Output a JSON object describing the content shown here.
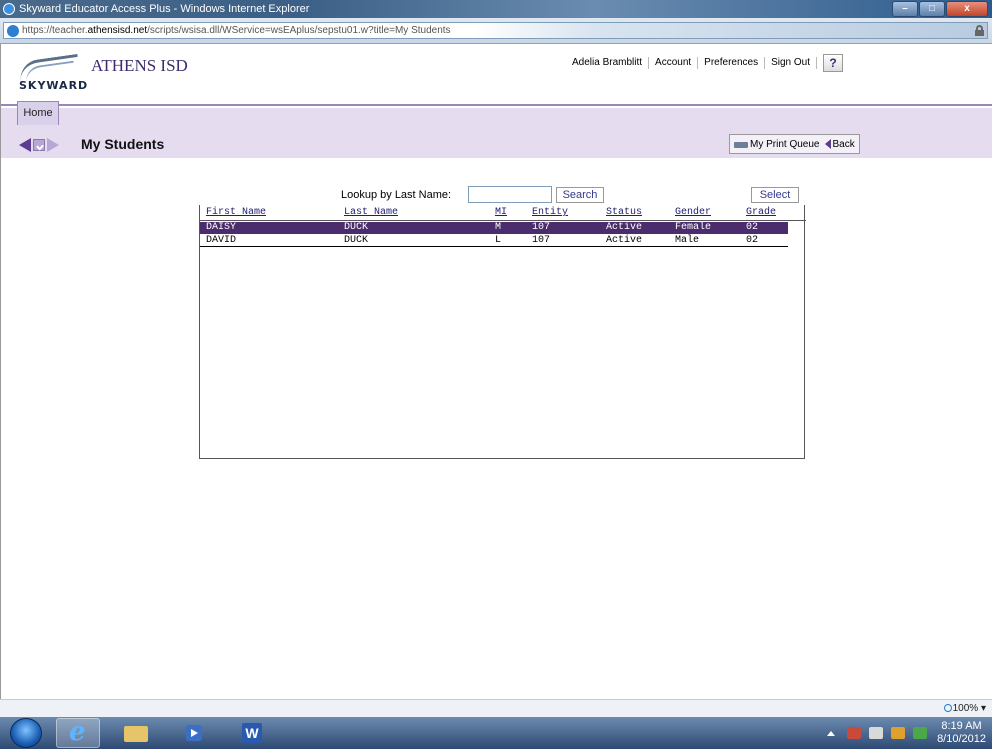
{
  "window": {
    "title": "Skyward Educator Access Plus - Windows Internet Explorer",
    "min": "–",
    "max": "□",
    "close": "x"
  },
  "address": {
    "prefix": "https://teacher.",
    "domain": "athensisd.net",
    "path": "/scripts/wsisa.dll/WService=wsEAplus/sepstu01.w?title=My Students"
  },
  "header": {
    "logo_text": "SKYWARD",
    "district": "ATHENS ISD",
    "user_name": "Adelia Bramblitt",
    "nav": [
      "Account",
      "Preferences",
      "Sign Out"
    ],
    "help": "?"
  },
  "tabs": {
    "home": "Home"
  },
  "toolbar": {
    "title": "My Students",
    "print_queue": "My Print Queue",
    "back": "Back"
  },
  "lookup": {
    "label": "Lookup by Last Name:",
    "value": "",
    "search_label": "Search",
    "select_label": "Select"
  },
  "grid": {
    "columns": [
      "First Name",
      "Last Name",
      "MI",
      "Entity",
      "Status",
      "Gender",
      "Grade"
    ],
    "rows": [
      {
        "first": "DAISY",
        "last": "DUCK",
        "mi": "M",
        "entity": "107",
        "status": "Active",
        "gender": "Female",
        "grade": "02",
        "selected": true
      },
      {
        "first": "DAVID",
        "last": "DUCK",
        "mi": "L",
        "entity": "107",
        "status": "Active",
        "gender": "Male",
        "grade": "02",
        "selected": false
      }
    ]
  },
  "statusbar": {
    "zoom": "100%",
    "zoom_arrow": "▾"
  },
  "taskbar": {
    "time": "8:19 AM",
    "date": "8/10/2012"
  },
  "colors": {
    "accent": "#4b2d6e",
    "toolbar_bg": "#e5dcf0",
    "link": "#333a8a"
  }
}
